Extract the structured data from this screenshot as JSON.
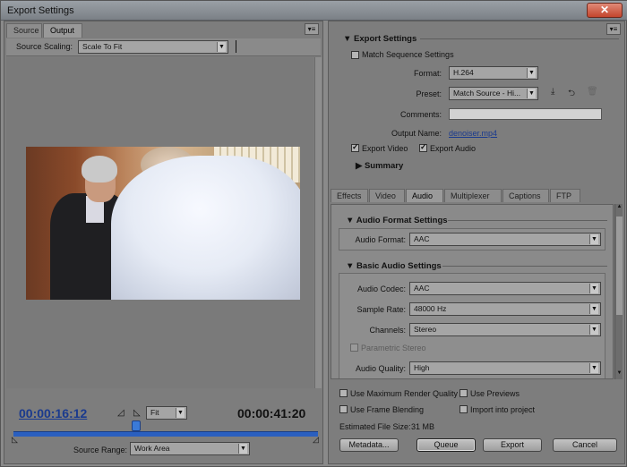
{
  "window": {
    "title": "Export Settings",
    "close_symbol": "✕"
  },
  "left": {
    "tabs": [
      "Source",
      "Output"
    ],
    "active_tab": "Output",
    "source_scaling_label": "Source Scaling:",
    "source_scaling_value": "Scale To Fit",
    "current_time": "00:00:16:12",
    "duration": "00:00:41:20",
    "zoom_value": "Fit",
    "source_range_label": "Source Range:",
    "source_range_value": "Work Area"
  },
  "export_settings": {
    "header": "Export Settings",
    "match_sequence_label": "Match Sequence Settings",
    "match_sequence_checked": false,
    "format_label": "Format:",
    "format_value": "H.264",
    "preset_label": "Preset:",
    "preset_value": "Match Source - Hi...",
    "comments_label": "Comments:",
    "comments_value": "",
    "output_name_label": "Output Name:",
    "output_name_value": "denoiser.mp4",
    "export_video_label": "Export Video",
    "export_video_checked": true,
    "export_audio_label": "Export Audio",
    "export_audio_checked": true,
    "summary_label": "Summary"
  },
  "settings_tabs": [
    "Effects",
    "Video",
    "Audio",
    "Multiplexer",
    "Captions",
    "FTP"
  ],
  "active_settings_tab": "Audio",
  "audio_format": {
    "header": "Audio Format Settings",
    "audio_format_label": "Audio Format:",
    "audio_format_value": "AAC"
  },
  "basic_audio": {
    "header": "Basic Audio Settings",
    "codec_label": "Audio Codec:",
    "codec_value": "AAC",
    "sample_rate_label": "Sample Rate:",
    "sample_rate_value": "48000 Hz",
    "channels_label": "Channels:",
    "channels_value": "Stereo",
    "parametric_stereo_label": "Parametric Stereo",
    "quality_label": "Audio Quality:",
    "quality_value": "High"
  },
  "options": {
    "max_render_label": "Use Maximum Render Quality",
    "use_previews_label": "Use Previews",
    "frame_blending_label": "Use Frame Blending",
    "import_project_label": "Import into project",
    "file_size_label": "Estimated File Size:",
    "file_size_value": "31 MB"
  },
  "buttons": {
    "metadata": "Metadata...",
    "queue": "Queue",
    "export": "Export",
    "cancel": "Cancel"
  }
}
